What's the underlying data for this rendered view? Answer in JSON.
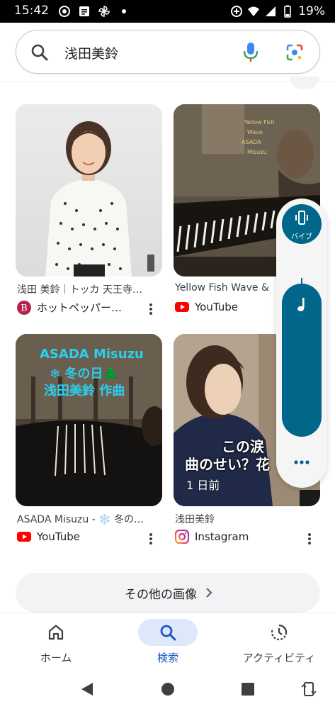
{
  "status_bar": {
    "time": "15:42",
    "battery": "19%"
  },
  "search": {
    "query": "浅田美鈴"
  },
  "results": [
    {
      "title": "浅田 美鈴｜トッカ 天王寺…",
      "source": "ホットペッパー…"
    },
    {
      "title": "Yellow Fish Wave &",
      "source": "YouTube"
    },
    {
      "title": "ASADA Misuzu - ❄️ 冬の…",
      "source": "YouTube",
      "overlay_lines": [
        "ASADA Misuzu",
        "❄ 冬の日🌲",
        "浅田美鈴 作曲"
      ]
    },
    {
      "title": "浅田美鈴",
      "source": "Instagram",
      "overlay_lines": [
        "この涙",
        "曲のせい？花"
      ],
      "time_badge": "1 日前"
    }
  ],
  "volume_panel": {
    "vibrate_label": "バイブ"
  },
  "more_images": {
    "label": "その他の画像"
  },
  "bottom_nav": {
    "items": [
      {
        "label": "ホーム",
        "icon": "home-icon"
      },
      {
        "label": "検索",
        "icon": "search-icon",
        "active": true
      },
      {
        "label": "アクティビティ",
        "icon": "activity-icon"
      }
    ]
  },
  "colors": {
    "accent": "#00668a",
    "active_nav": "#1a56c4",
    "active_pill": "#dfe8fb",
    "youtube_red": "#ff0000"
  }
}
